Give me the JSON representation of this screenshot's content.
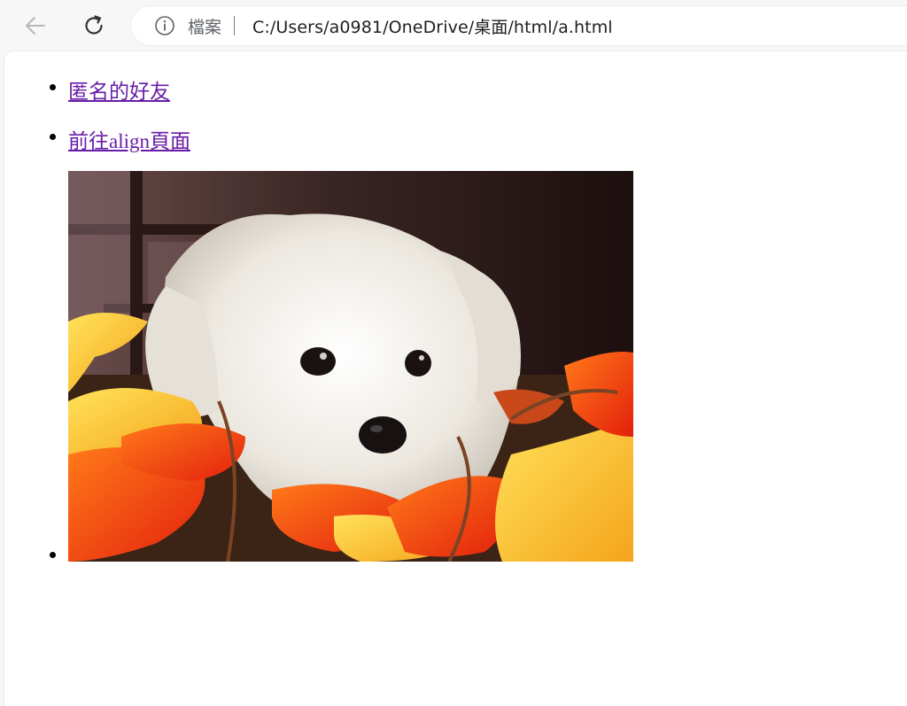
{
  "browser": {
    "back_icon": "arrow-left-icon",
    "reload_icon": "reload-icon",
    "info_icon": "info-circle-icon",
    "scheme_label": "檔案",
    "url": "C:/Users/a0981/OneDrive/桌面/html/a.html"
  },
  "page": {
    "links": [
      {
        "label": "匿名的好友"
      },
      {
        "label": "前往align頁面"
      }
    ],
    "image": {
      "subject": "white puppy among autumn leaves"
    }
  },
  "colors": {
    "link_visited": "#681da8",
    "toolbar_bg": "#f7f7f7",
    "page_bg": "#ffffff"
  }
}
